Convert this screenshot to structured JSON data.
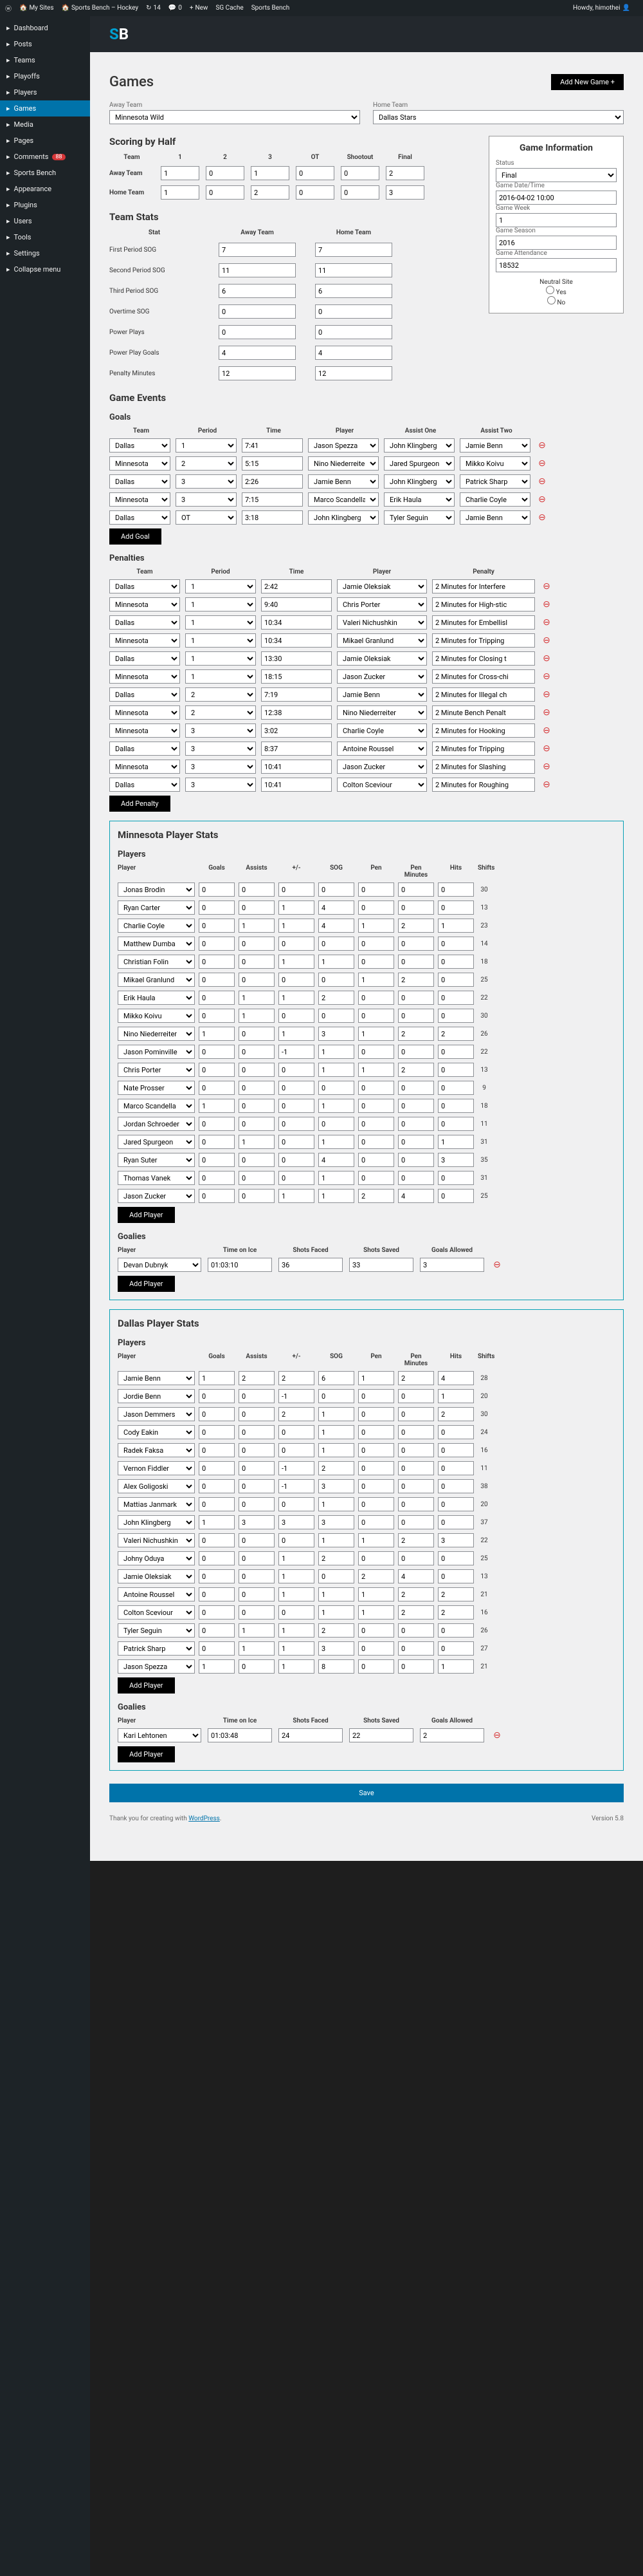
{
  "topbar": {
    "mysites": "My Sites",
    "sitename": "Sports Bench – Hockey",
    "updates": "14",
    "comments": "0",
    "new": "New",
    "cache": "SG Cache",
    "app": "Sports Bench",
    "greeting": "Howdy, himothei"
  },
  "sidebar": [
    {
      "label": "Dashboard"
    },
    {
      "label": "Posts"
    },
    {
      "label": "Teams"
    },
    {
      "label": "Playoffs"
    },
    {
      "label": "Players"
    },
    {
      "label": "Games",
      "active": true
    },
    {
      "label": "Media"
    },
    {
      "label": "Pages"
    },
    {
      "label": "Comments",
      "badge": "88"
    },
    {
      "label": "Sports Bench"
    },
    {
      "label": "Appearance"
    },
    {
      "label": "Plugins"
    },
    {
      "label": "Users"
    },
    {
      "label": "Tools"
    },
    {
      "label": "Settings"
    },
    {
      "label": "Collapse menu"
    }
  ],
  "page": {
    "title": "Games",
    "addnew": "Add New Game +"
  },
  "teams": {
    "away_label": "Away Team",
    "away": "Minnesota Wild",
    "home_label": "Home Team",
    "home": "Dallas Stars"
  },
  "scoring": {
    "title": "Scoring by Half",
    "cols": [
      "Team",
      "1",
      "2",
      "3",
      "OT",
      "Shootout",
      "Final"
    ],
    "away_label": "Away Team",
    "away": [
      "1",
      "0",
      "1",
      "0",
      "0",
      "2"
    ],
    "home_label": "Home Team",
    "home": [
      "1",
      "0",
      "2",
      "0",
      "0",
      "3"
    ]
  },
  "info": {
    "title": "Game Information",
    "status_label": "Status",
    "status": "Final",
    "datetime_label": "Game Date/Time",
    "datetime": "2016-04-02 10:00",
    "week_label": "Game Week",
    "week": "1",
    "season_label": "Game Season",
    "season": "2016",
    "attendance_label": "Game Attendance",
    "attendance": "18532",
    "neutral_label": "Neutral Site",
    "yes": "Yes",
    "no": "No"
  },
  "teamstats": {
    "title": "Team Stats",
    "cols": [
      "Stat",
      "Away Team",
      "Home Team"
    ],
    "rows": [
      {
        "label": "First Period SOG",
        "away": "7",
        "home": "7"
      },
      {
        "label": "Second Period SOG",
        "away": "11",
        "home": "11"
      },
      {
        "label": "Third Period SOG",
        "away": "6",
        "home": "6"
      },
      {
        "label": "Overtime SOG",
        "away": "0",
        "home": "0"
      },
      {
        "label": "Power Plays",
        "away": "0",
        "home": "0"
      },
      {
        "label": "Power Play Goals",
        "away": "4",
        "home": "4"
      },
      {
        "label": "Penalty Minutes",
        "away": "12",
        "home": "12"
      }
    ]
  },
  "events": {
    "title": "Game Events",
    "goals_title": "Goals",
    "cols": [
      "Team",
      "Period",
      "Time",
      "Player",
      "Assist One",
      "Assist Two"
    ],
    "goals": [
      {
        "team": "Dallas",
        "period": "1",
        "time": "7:41",
        "player": "Jason Spezza",
        "a1": "John Klingberg",
        "a2": "Jamie Benn"
      },
      {
        "team": "Minnesota",
        "period": "2",
        "time": "5:15",
        "player": "Nino Niederreiter",
        "a1": "Jared Spurgeon",
        "a2": "Mikko Koivu"
      },
      {
        "team": "Dallas",
        "period": "3",
        "time": "2:26",
        "player": "Jamie Benn",
        "a1": "John Klingberg",
        "a2": "Patrick Sharp"
      },
      {
        "team": "Minnesota",
        "period": "3",
        "time": "7:15",
        "player": "Marco Scandella",
        "a1": "Erik Haula",
        "a2": "Charlie Coyle"
      },
      {
        "team": "Dallas",
        "period": "OT",
        "time": "3:18",
        "player": "John Klingberg",
        "a1": "Tyler Seguin",
        "a2": "Jamie Benn"
      }
    ],
    "add_goal": "Add Goal",
    "penalties_title": "Penalties",
    "pcols": [
      "Team",
      "Period",
      "Time",
      "Player",
      "Penalty"
    ],
    "penalties": [
      {
        "team": "Dallas",
        "period": "1",
        "time": "2:42",
        "player": "Jamie Oleksiak",
        "pen": "2 Minutes for Interfere"
      },
      {
        "team": "Minnesota",
        "period": "1",
        "time": "9:40",
        "player": "Chris Porter",
        "pen": "2 Minutes for High-stic"
      },
      {
        "team": "Dallas",
        "period": "1",
        "time": "10:34",
        "player": "Valeri Nichushkin",
        "pen": "2 Minutes for Embellisl"
      },
      {
        "team": "Minnesota",
        "period": "1",
        "time": "10:34",
        "player": "Mikael Granlund",
        "pen": "2 Minutes for Tripping"
      },
      {
        "team": "Dallas",
        "period": "1",
        "time": "13:30",
        "player": "Jamie Oleksiak",
        "pen": "2 Minutes for Closing t"
      },
      {
        "team": "Minnesota",
        "period": "1",
        "time": "18:15",
        "player": "Jason Zucker",
        "pen": "2 Minutes for Cross-chi"
      },
      {
        "team": "Dallas",
        "period": "2",
        "time": "7:19",
        "player": "Jamie Benn",
        "pen": "2 Minutes for Illegal ch"
      },
      {
        "team": "Minnesota",
        "period": "2",
        "time": "12:38",
        "player": "Nino Niederreiter",
        "pen": "2 Minute Bench Penalt"
      },
      {
        "team": "Minnesota",
        "period": "3",
        "time": "3:02",
        "player": "Charlie Coyle",
        "pen": "2 Minutes for Hooking"
      },
      {
        "team": "Dallas",
        "period": "3",
        "time": "8:37",
        "player": "Antoine Roussel",
        "pen": "2 Minutes for Tripping"
      },
      {
        "team": "Minnesota",
        "period": "3",
        "time": "10:41",
        "player": "Jason Zucker",
        "pen": "2 Minutes for Slashing"
      },
      {
        "team": "Dallas",
        "period": "3",
        "time": "10:41",
        "player": "Colton Sceviour",
        "pen": "2 Minutes for Roughing"
      }
    ],
    "add_penalty": "Add Penalty"
  },
  "mn": {
    "title": "Minnesota Player Stats",
    "players_title": "Players",
    "cols": [
      "Player",
      "Goals",
      "Assists",
      "+/-",
      "SOG",
      "Pen",
      "Pen Minutes",
      "Hits",
      "Shifts"
    ],
    "players": [
      {
        "name": "Jonas Brodin",
        "v": [
          "0",
          "0",
          "0",
          "0",
          "0",
          "0",
          "0",
          "30"
        ]
      },
      {
        "name": "Ryan Carter",
        "v": [
          "0",
          "0",
          "1",
          "4",
          "0",
          "0",
          "0",
          "13"
        ]
      },
      {
        "name": "Charlie Coyle",
        "v": [
          "0",
          "1",
          "1",
          "4",
          "1",
          "2",
          "1",
          "23"
        ]
      },
      {
        "name": "Matthew Dumba",
        "v": [
          "0",
          "0",
          "0",
          "0",
          "0",
          "0",
          "0",
          "14"
        ]
      },
      {
        "name": "Christian Folin",
        "v": [
          "0",
          "0",
          "1",
          "1",
          "0",
          "0",
          "0",
          "18"
        ]
      },
      {
        "name": "Mikael Granlund",
        "v": [
          "0",
          "0",
          "0",
          "0",
          "1",
          "2",
          "0",
          "25"
        ]
      },
      {
        "name": "Erik Haula",
        "v": [
          "0",
          "1",
          "1",
          "2",
          "0",
          "0",
          "0",
          "22"
        ]
      },
      {
        "name": "Mikko Koivu",
        "v": [
          "0",
          "1",
          "0",
          "0",
          "0",
          "0",
          "0",
          "30"
        ]
      },
      {
        "name": "Nino Niederreiter",
        "v": [
          "1",
          "0",
          "1",
          "3",
          "1",
          "2",
          "2",
          "26"
        ]
      },
      {
        "name": "Jason Pominville",
        "v": [
          "0",
          "0",
          "-1",
          "1",
          "0",
          "0",
          "0",
          "22"
        ]
      },
      {
        "name": "Chris Porter",
        "v": [
          "0",
          "0",
          "0",
          "1",
          "1",
          "2",
          "0",
          "13"
        ]
      },
      {
        "name": "Nate Prosser",
        "v": [
          "0",
          "0",
          "0",
          "0",
          "0",
          "0",
          "0",
          "9"
        ]
      },
      {
        "name": "Marco Scandella",
        "v": [
          "1",
          "0",
          "0",
          "1",
          "0",
          "0",
          "0",
          "18"
        ]
      },
      {
        "name": "Jordan Schroeder",
        "v": [
          "0",
          "0",
          "0",
          "0",
          "0",
          "0",
          "0",
          "11"
        ]
      },
      {
        "name": "Jared Spurgeon",
        "v": [
          "0",
          "1",
          "0",
          "1",
          "0",
          "0",
          "1",
          "31"
        ]
      },
      {
        "name": "Ryan Suter",
        "v": [
          "0",
          "0",
          "0",
          "4",
          "0",
          "0",
          "3",
          "35"
        ]
      },
      {
        "name": "Thomas Vanek",
        "v": [
          "0",
          "0",
          "0",
          "1",
          "0",
          "0",
          "0",
          "31"
        ]
      },
      {
        "name": "Jason Zucker",
        "v": [
          "0",
          "0",
          "1",
          "1",
          "2",
          "4",
          "0",
          "25"
        ]
      }
    ],
    "goalies_title": "Goalies",
    "gcols": [
      "Player",
      "Time on Ice",
      "Shots Faced",
      "Shots Saved",
      "Goals Allowed"
    ],
    "goalies": [
      {
        "name": "Devan Dubnyk",
        "toi": "01:03:10",
        "sf": "36",
        "ss": "33",
        "ga": "3"
      }
    ],
    "add_player": "Add Player"
  },
  "dal": {
    "title": "Dallas Player Stats",
    "players_title": "Players",
    "players": [
      {
        "name": "Jamie Benn",
        "v": [
          "1",
          "2",
          "2",
          "6",
          "1",
          "2",
          "4",
          "28"
        ]
      },
      {
        "name": "Jordie Benn",
        "v": [
          "0",
          "0",
          "-1",
          "0",
          "0",
          "0",
          "1",
          "20"
        ]
      },
      {
        "name": "Jason Demmers",
        "v": [
          "0",
          "0",
          "2",
          "1",
          "0",
          "0",
          "2",
          "30"
        ]
      },
      {
        "name": "Cody Eakin",
        "v": [
          "0",
          "0",
          "0",
          "1",
          "0",
          "0",
          "0",
          "24"
        ]
      },
      {
        "name": "Radek Faksa",
        "v": [
          "0",
          "0",
          "0",
          "1",
          "0",
          "0",
          "0",
          "16"
        ]
      },
      {
        "name": "Vernon Fiddler",
        "v": [
          "0",
          "0",
          "-1",
          "2",
          "0",
          "0",
          "0",
          "11"
        ]
      },
      {
        "name": "Alex Goligoski",
        "v": [
          "0",
          "0",
          "-1",
          "3",
          "0",
          "0",
          "0",
          "38"
        ]
      },
      {
        "name": "Mattias Janmark",
        "v": [
          "0",
          "0",
          "0",
          "1",
          "0",
          "0",
          "0",
          "20"
        ]
      },
      {
        "name": "John Klingberg",
        "v": [
          "1",
          "3",
          "3",
          "3",
          "0",
          "0",
          "0",
          "37"
        ]
      },
      {
        "name": "Valeri Nichushkin",
        "v": [
          "0",
          "0",
          "0",
          "1",
          "1",
          "2",
          "3",
          "22"
        ]
      },
      {
        "name": "Johny Oduya",
        "v": [
          "0",
          "0",
          "1",
          "2",
          "0",
          "0",
          "0",
          "25"
        ]
      },
      {
        "name": "Jamie Oleksiak",
        "v": [
          "0",
          "0",
          "1",
          "0",
          "2",
          "4",
          "0",
          "13"
        ]
      },
      {
        "name": "Antoine Roussel",
        "v": [
          "0",
          "0",
          "1",
          "1",
          "1",
          "2",
          "2",
          "21"
        ]
      },
      {
        "name": "Colton Sceviour",
        "v": [
          "0",
          "0",
          "0",
          "1",
          "1",
          "2",
          "2",
          "16"
        ]
      },
      {
        "name": "Tyler Seguin",
        "v": [
          "0",
          "1",
          "1",
          "2",
          "0",
          "0",
          "0",
          "26"
        ]
      },
      {
        "name": "Patrick Sharp",
        "v": [
          "0",
          "1",
          "1",
          "3",
          "0",
          "0",
          "0",
          "27"
        ]
      },
      {
        "name": "Jason Spezza",
        "v": [
          "1",
          "0",
          "1",
          "8",
          "0",
          "0",
          "1",
          "21"
        ]
      }
    ],
    "goalies": [
      {
        "name": "Kari Lehtonen",
        "toi": "01:03:48",
        "sf": "24",
        "ss": "22",
        "ga": "2"
      }
    ]
  },
  "save": "Save",
  "footer": {
    "thanks": "Thank you for creating with ",
    "wp": "WordPress",
    "ver": "Version 5.8"
  }
}
